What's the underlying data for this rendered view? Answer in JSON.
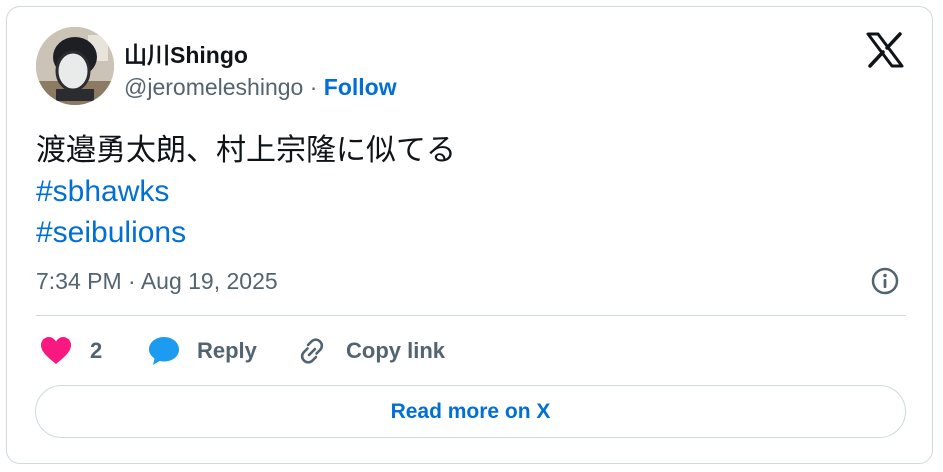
{
  "author": {
    "display_name": "山川Shingo",
    "handle": "@jeromeleshingo",
    "separator": "·",
    "follow_label": "Follow"
  },
  "tweet": {
    "text": "渡邉勇太朗、村上宗隆に似てる",
    "hashtags": [
      "#sbhawks",
      "#seibulions"
    ],
    "timestamp": "7:34 PM · Aug 19, 2025"
  },
  "actions": {
    "like_count": "2",
    "reply_label": "Reply",
    "copy_link_label": "Copy link"
  },
  "read_more_label": "Read more on X",
  "icons": [
    "avatar",
    "x-logo-icon",
    "info-icon",
    "heart-icon",
    "reply-bubble-icon",
    "link-icon"
  ],
  "colors": {
    "link_blue": "#006fd6",
    "heart_pink": "#f91880",
    "reply_blue": "#1d9bf0",
    "secondary_text": "#536471",
    "border": "#cfd9de"
  }
}
